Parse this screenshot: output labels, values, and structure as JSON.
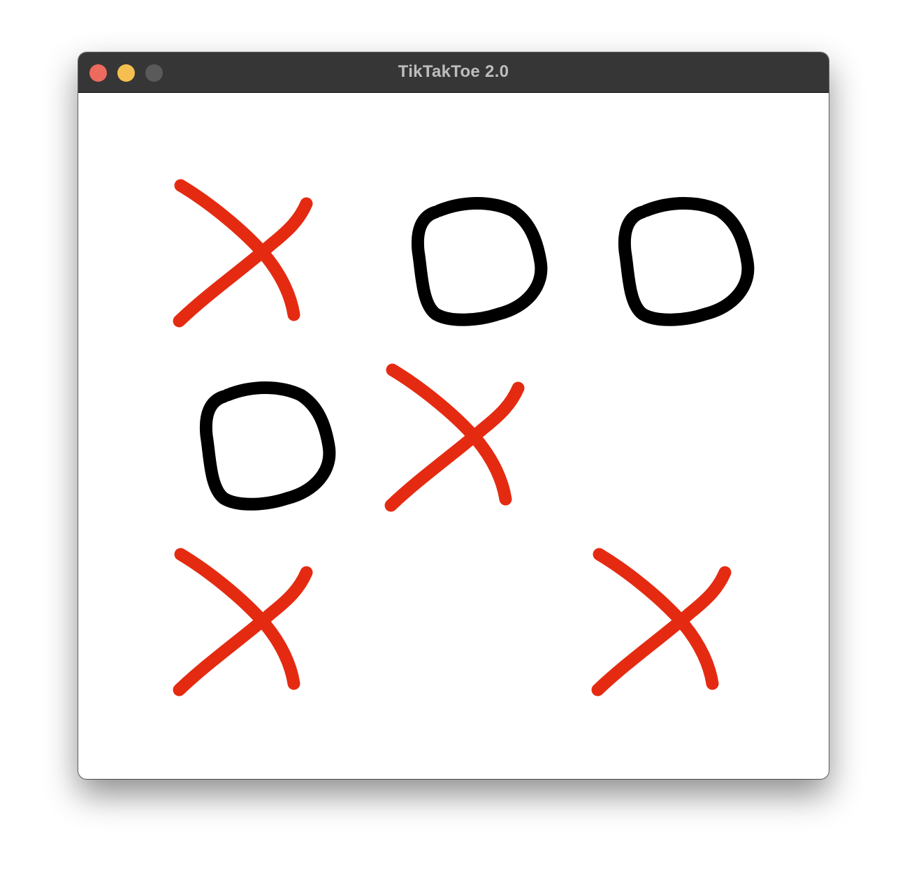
{
  "window": {
    "title": "TikTakToe 2.0"
  },
  "colors": {
    "x_mark": "#e42b12",
    "o_mark": "#000000",
    "grid": "#000000",
    "titlebar": "#363636"
  },
  "board": {
    "cells": [
      "X",
      "O",
      "O",
      "O",
      "X",
      "",
      "X",
      "",
      "X"
    ]
  }
}
